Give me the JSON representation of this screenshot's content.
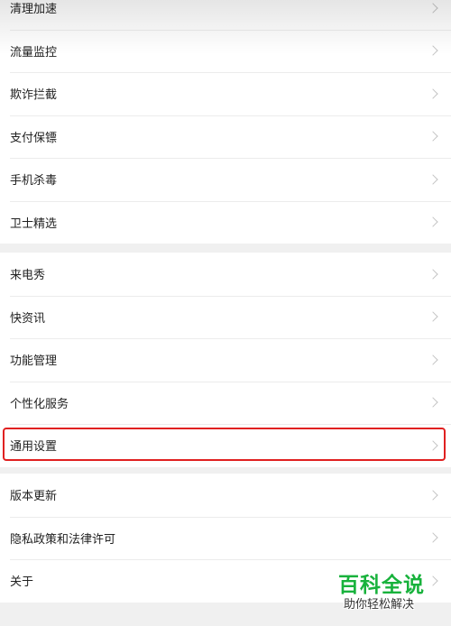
{
  "groups": [
    {
      "items": [
        {
          "label": "清理加速"
        },
        {
          "label": "流量监控"
        },
        {
          "label": "欺诈拦截"
        },
        {
          "label": "支付保镖"
        },
        {
          "label": "手机杀毒"
        },
        {
          "label": "卫士精选"
        }
      ]
    },
    {
      "items": [
        {
          "label": "来电秀"
        },
        {
          "label": "快资讯"
        },
        {
          "label": "功能管理"
        },
        {
          "label": "个性化服务"
        },
        {
          "label": "通用设置"
        }
      ]
    },
    {
      "items": [
        {
          "label": "版本更新"
        },
        {
          "label": "隐私政策和法律许可"
        },
        {
          "label": "关于"
        }
      ]
    }
  ],
  "highlighted_item": "通用设置",
  "watermark": {
    "title": "百科全说",
    "subtitle": "助你轻松解决",
    "color": "#18b23c"
  },
  "colors": {
    "highlight_border": "#e02020",
    "background": "#f0f0f0"
  },
  "icons": {
    "chevron": "chevron-right-icon"
  }
}
